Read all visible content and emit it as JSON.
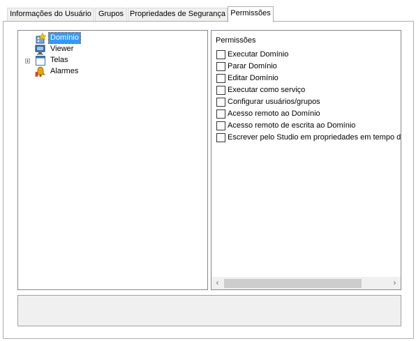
{
  "tabs": [
    {
      "label": "Informações do Usuário"
    },
    {
      "label": "Grupos"
    },
    {
      "label": "Propriedades de Segurança"
    },
    {
      "label": "Permissões"
    }
  ],
  "active_tab": "Permissões",
  "tree": {
    "items": [
      {
        "label": "Domínio",
        "icon": "domain-icon",
        "selected": true
      },
      {
        "label": "Viewer",
        "icon": "viewer-icon"
      },
      {
        "label": "Telas",
        "icon": "screens-icon",
        "expander": "+"
      },
      {
        "label": "Alarmes",
        "icon": "alarm-bell-icon"
      }
    ]
  },
  "permissions": {
    "title": "Permissões",
    "items": [
      {
        "label": "Executar Domínio",
        "checked": false
      },
      {
        "label": "Parar Domínio",
        "checked": false
      },
      {
        "label": "Editar Domínio",
        "checked": false
      },
      {
        "label": "Executar como serviço",
        "checked": false
      },
      {
        "label": "Configurar usuários/grupos",
        "checked": false
      },
      {
        "label": "Acesso remoto ao Domínio",
        "checked": false
      },
      {
        "label": "Acesso remoto de escrita ao Domínio",
        "checked": false
      },
      {
        "label": "Escrever pelo Studio em propriedades em tempo de",
        "checked": false
      }
    ],
    "scrollbar": {
      "left_arrow": "‹",
      "right_arrow": "›"
    }
  },
  "colors": {
    "selection": "#3399ff",
    "tab_bg": "#f0f0f0",
    "border": "#828790"
  }
}
